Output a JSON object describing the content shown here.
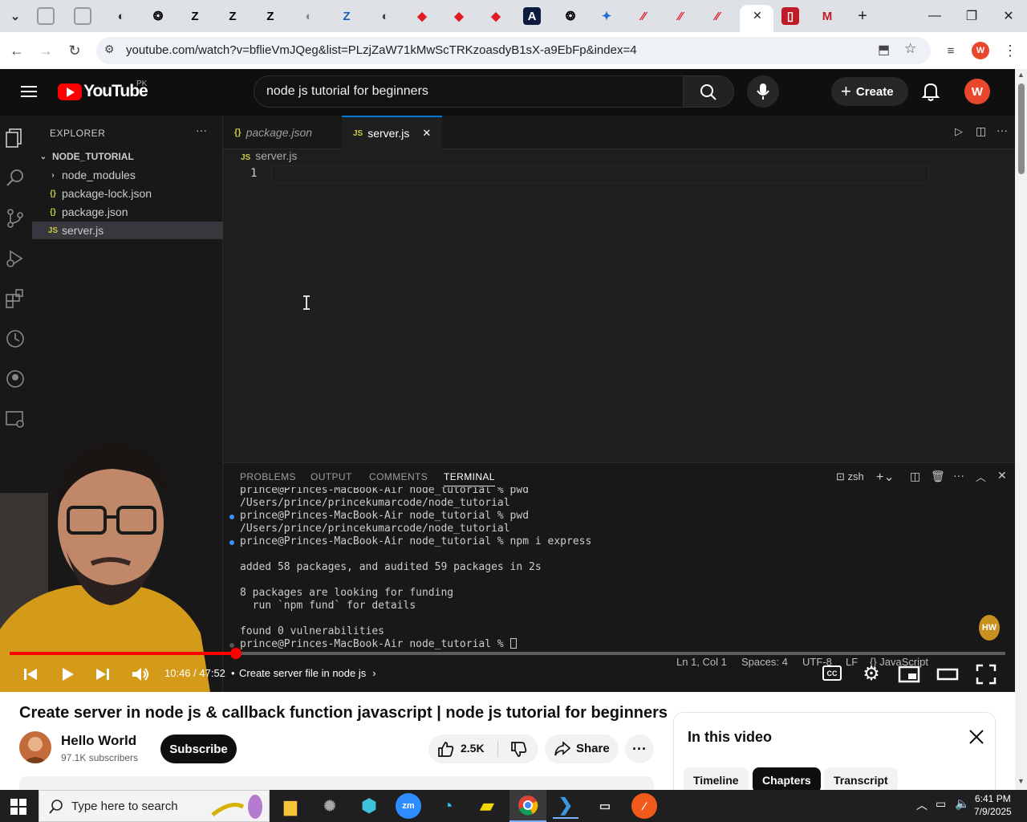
{
  "browser": {
    "url": "youtube.com/watch?v=bflieVmJQeg&list=PLzjZaW71kMwScTRKzoasdyB1sX-a9EbFp&index=4",
    "active_tab_close": "✕",
    "new_tab": "+"
  },
  "youtube": {
    "logo_text": "YouTube",
    "region": "PK",
    "search_query": "node js tutorial for beginners",
    "create_label": "Create",
    "avatar_letter": "W"
  },
  "vscode": {
    "explorer_title": "EXPLORER",
    "project": "NODE_TUTORIAL",
    "files": [
      {
        "name": "node_modules",
        "icon": "›",
        "color": "#cccccc"
      },
      {
        "name": "package-lock.json",
        "icon": "{}",
        "color": "#cbcb41"
      },
      {
        "name": "package.json",
        "icon": "{}",
        "color": "#cbcb41"
      },
      {
        "name": "server.js",
        "icon": "JS",
        "color": "#cbcb41"
      }
    ],
    "tabs": [
      "package.json",
      "server.js"
    ],
    "breadcrumb": "server.js",
    "line_number": "1",
    "panel_tabs": [
      "PROBLEMS",
      "OUTPUT",
      "COMMENTS",
      "TERMINAL"
    ],
    "shell": "zsh",
    "terminal": [
      "prince@Princes-MacBook-Air node_tutorial % pwd",
      "/Users/prince/princekumarcode/node_tutorial",
      "prince@Princes-MacBook-Air node_tutorial % pwd",
      "/Users/prince/princekumarcode/node_tutorial",
      "prince@Princes-MacBook-Air node_tutorial % npm i express",
      "",
      "added 58 packages, and audited 59 packages in 2s",
      "",
      "8 packages are looking for funding",
      "  run `npm fund` for details",
      "",
      "found 0 vulnerabilities",
      "prince@Princes-MacBook-Air node_tutorial % "
    ],
    "status": {
      "position": "Ln 1, Col 1",
      "spaces": "Spaces: 4",
      "encoding": "UTF-8",
      "eol": "LF",
      "language": "JavaScript"
    }
  },
  "player": {
    "time": "10:46 / 47:52",
    "chapter": "Create server file in node js",
    "progress": 0.227,
    "watermark": "HW"
  },
  "video": {
    "title": "Create server in node js & callback function javascript | node js tutorial for beginners",
    "channel": "Hello World",
    "subscribers": "97.1K subscribers",
    "subscribe_label": "Subscribe",
    "likes": "2.5K",
    "share_label": "Share"
  },
  "chapters_panel": {
    "title": "In this video",
    "chips": [
      "Timeline",
      "Chapters",
      "Transcript"
    ]
  },
  "taskbar": {
    "search_placeholder": "Type here to search",
    "time": "6:41 PM",
    "date": "7/9/2025"
  }
}
